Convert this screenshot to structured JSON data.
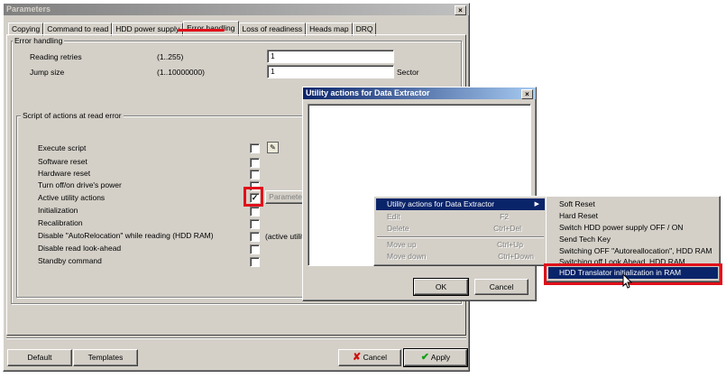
{
  "main": {
    "title": "Parameters",
    "tabs": [
      "Copying",
      "Command to read",
      "HDD power supply",
      "Error handling",
      "Loss of readiness",
      "Heads map",
      "DRQ"
    ],
    "active_tab": "Error handling",
    "error_group": {
      "title": "Error handling",
      "reading_retries_label": "Reading retries",
      "reading_retries_range": "(1..255)",
      "reading_retries_value": "1",
      "jump_size_label": "Jump size",
      "jump_size_range": "(1..10000000)",
      "jump_size_value": "1",
      "jump_size_unit": "Sector"
    },
    "script_group": {
      "title": "Script of actions at read error",
      "items": [
        {
          "label": "Execute script",
          "checked": false
        },
        {
          "label": "Software reset",
          "checked": false
        },
        {
          "label": "Hardware reset",
          "checked": false
        },
        {
          "label": "Turn off/on drive's power",
          "checked": false
        },
        {
          "label": "Active utility actions",
          "checked": true
        },
        {
          "label": "Initialization",
          "checked": false
        },
        {
          "label": "Recalibration",
          "checked": false
        },
        {
          "label": "Disable \"AutoRelocation\" while reading (HDD RAM)",
          "checked": false
        },
        {
          "label": "Disable read look-ahead",
          "checked": false
        },
        {
          "label": "Standby command",
          "checked": false
        }
      ],
      "parameters_button": "Parameter",
      "active_utility_note": "(active utility"
    },
    "buttons": {
      "default": "Default",
      "templates": "Templates",
      "cancel": "Cancel",
      "apply": "Apply"
    }
  },
  "utility_dialog": {
    "title": "Utility actions for Data Extractor",
    "ok": "OK",
    "cancel": "Cancel"
  },
  "context_menu": {
    "items": [
      {
        "label": "Utility actions for Data Extractor",
        "shortcut": "",
        "selected": true,
        "disabled": false,
        "submenu": true
      },
      {
        "label": "Edit",
        "shortcut": "F2",
        "selected": false,
        "disabled": true
      },
      {
        "label": "Delete",
        "shortcut": "Ctrl+Del",
        "selected": false,
        "disabled": true
      },
      {
        "label": "Move up",
        "shortcut": "Ctrl+Up",
        "selected": false,
        "disabled": true
      },
      {
        "label": "Move down",
        "shortcut": "Ctrl+Down",
        "selected": false,
        "disabled": true
      }
    ]
  },
  "submenu": {
    "items": [
      "Soft Reset",
      "Hard Reset",
      "Switch HDD power supply OFF / ON",
      "Send Tech Key",
      "Switching OFF \"Autoreallocation\", HDD RAM",
      "Switching off Look Ahead, HDD RAM",
      "HDD Translator initialization in RAM"
    ],
    "selected_index": 6
  },
  "colors": {
    "highlight": "#e0101a",
    "selection": "#0a246a",
    "face": "#d4d0c8"
  }
}
